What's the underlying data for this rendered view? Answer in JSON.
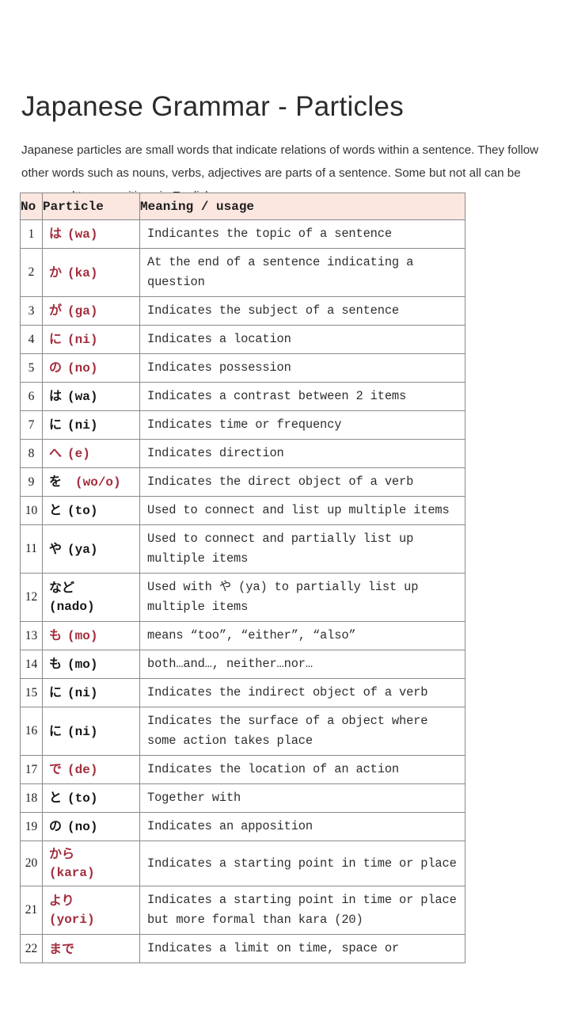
{
  "title": "Japanese Grammar - Particles",
  "intro": "Japanese particles are small words that indicate relations of words within a sentence. They follow other words such as nouns, verbs, adjectives are parts of a sentence. Some but not all can be compared to prepositions in English.",
  "table": {
    "headers": {
      "no": "No",
      "particle": "Particle",
      "meaning": "Meaning / usage"
    },
    "rows": [
      {
        "no": "1",
        "kana": "は",
        "roma": "(wa)",
        "color": "red",
        "layout": "inline",
        "meaning": "Indicantes the topic of a sentence"
      },
      {
        "no": "2",
        "kana": "か",
        "roma": "(ka)",
        "color": "red",
        "layout": "inline",
        "meaning": "At the end of a sentence indicating a question"
      },
      {
        "no": "3",
        "kana": "が",
        "roma": "(ga)",
        "color": "red",
        "layout": "inline",
        "meaning": "Indicates the subject of a sentence"
      },
      {
        "no": "4",
        "kana": "に",
        "roma": "(ni)",
        "color": "red",
        "layout": "inline",
        "meaning": "Indicates a location"
      },
      {
        "no": "5",
        "kana": "の",
        "roma": "(no)",
        "color": "red",
        "layout": "inline",
        "meaning": "Indicates possession"
      },
      {
        "no": "6",
        "kana": "は",
        "roma": "(wa)",
        "color": "black",
        "layout": "inline",
        "meaning": "Indicates a contrast between 2 items"
      },
      {
        "no": "7",
        "kana": "に",
        "roma": "(ni)",
        "color": "black",
        "layout": "inline",
        "meaning": "Indicates time or frequency"
      },
      {
        "no": "8",
        "kana": "へ",
        "roma": "(e)",
        "color": "red",
        "layout": "inline",
        "meaning": "Indicates direction"
      },
      {
        "no": "9",
        "kana": "を",
        "roma": "(wo/o)",
        "color": "mixed",
        "layout": "wide",
        "meaning": "Indicates the direct object of a verb"
      },
      {
        "no": "10",
        "kana": "と",
        "roma": "(to)",
        "color": "black",
        "layout": "inline",
        "meaning": "Used to connect and list up multiple items"
      },
      {
        "no": "11",
        "kana": "や",
        "roma": "(ya)",
        "color": "black",
        "layout": "inline",
        "meaning": "Used to connect and partially list up multiple items"
      },
      {
        "no": "12",
        "kana": "など",
        "roma": "(nado)",
        "color": "black",
        "layout": "stack",
        "meaning": "Used with や (ya) to partially list up multiple items"
      },
      {
        "no": "13",
        "kana": "も",
        "roma": "(mo)",
        "color": "red",
        "layout": "inline",
        "meaning": "means “too”, “either”, “also”"
      },
      {
        "no": "14",
        "kana": "も",
        "roma": "(mo)",
        "color": "black",
        "layout": "inline",
        "meaning": "both…and…, neither…nor…"
      },
      {
        "no": "15",
        "kana": "に",
        "roma": "(ni)",
        "color": "black",
        "layout": "inline",
        "meaning": "Indicates the indirect object of a verb"
      },
      {
        "no": "16",
        "kana": "に",
        "roma": "(ni)",
        "color": "black",
        "layout": "inline",
        "meaning": "Indicates the surface of a object where some action takes place"
      },
      {
        "no": "17",
        "kana": "で",
        "roma": "(de)",
        "color": "red",
        "layout": "inline",
        "meaning": "Indicates the location of an action"
      },
      {
        "no": "18",
        "kana": "と",
        "roma": "(to)",
        "color": "black",
        "layout": "inline",
        "meaning": "Together with"
      },
      {
        "no": "19",
        "kana": "の",
        "roma": "(no)",
        "color": "black",
        "layout": "inline",
        "meaning": "Indicates an apposition"
      },
      {
        "no": "20",
        "kana": "から",
        "roma": "(kara)",
        "color": "red",
        "layout": "stack",
        "meaning": "Indicates a starting point in time or place"
      },
      {
        "no": "21",
        "kana": "より",
        "roma": "(yori)",
        "color": "red",
        "layout": "stack",
        "meaning": "Indicates a starting point in time or place but more formal than kara (20)"
      },
      {
        "no": "22",
        "kana": "まで",
        "roma": "",
        "color": "red",
        "layout": "inline",
        "meaning": "Indicates a limit on time, space or"
      }
    ]
  },
  "colors": {
    "particle_red": "#a32d3c",
    "particle_black": "#161616",
    "header_bg": "#fbe6e0",
    "border": "#8a8a8a",
    "page_bg": "#ffffff"
  }
}
